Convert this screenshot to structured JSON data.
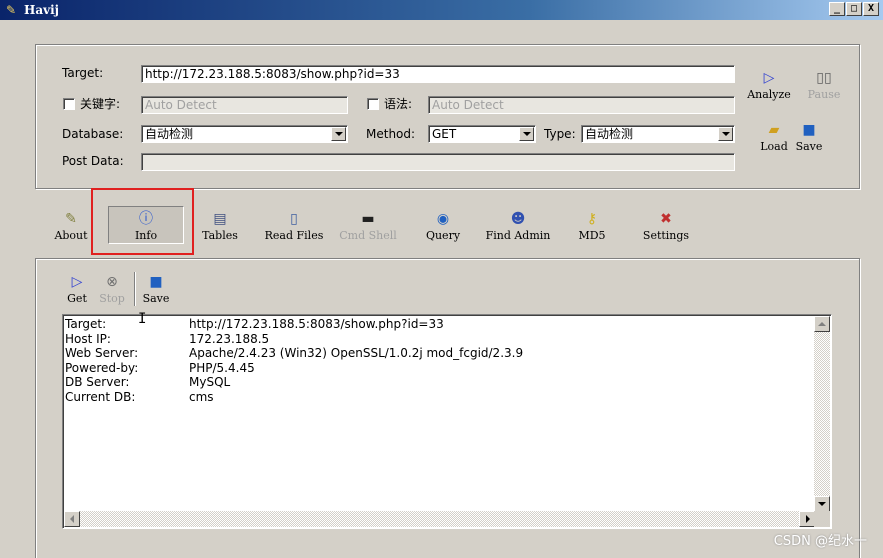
{
  "window": {
    "title": "Havij",
    "min": "_",
    "max": "□",
    "close": "X"
  },
  "form": {
    "target_label": "Target:",
    "target_value": "http://172.23.188.5:8083/show.php?id=33",
    "keyword_label": "关键字:",
    "keyword_placeholder": "Auto Detect",
    "syntax_label": "语法:",
    "syntax_placeholder": "Auto Detect",
    "database_label": "Database:",
    "database_value": "自动检测",
    "method_label": "Method:",
    "method_value": "GET",
    "type_label": "Type:",
    "type_value": "自动检测",
    "postdata_label": "Post Data:",
    "postdata_value": ""
  },
  "side_buttons": {
    "analyze": "Analyze",
    "pause": "Pause",
    "load": "Load",
    "save": "Save"
  },
  "tabs": [
    {
      "label": "About",
      "icon": "tool-icon"
    },
    {
      "label": "Info",
      "icon": "info-icon"
    },
    {
      "label": "Tables",
      "icon": "table-icon"
    },
    {
      "label": "Read Files",
      "icon": "file-icon"
    },
    {
      "label": "Cmd Shell",
      "icon": "terminal-icon"
    },
    {
      "label": "Query",
      "icon": "query-icon"
    },
    {
      "label": "Find Admin",
      "icon": "users-icon"
    },
    {
      "label": "MD5",
      "icon": "key-icon"
    },
    {
      "label": "Settings",
      "icon": "settings-icon"
    }
  ],
  "info_toolbar": {
    "get": "Get",
    "stop": "Stop",
    "save": "Save"
  },
  "output": [
    {
      "key": "Target:",
      "value": "http://172.23.188.5:8083/show.php?id=33"
    },
    {
      "key": "Host IP:",
      "value": "172.23.188.5"
    },
    {
      "key": "Web Server:",
      "value": "Apache/2.4.23 (Win32) OpenSSL/1.0.2j mod_fcgid/2.3.9"
    },
    {
      "key": "Powered-by:",
      "value": "PHP/5.4.45"
    },
    {
      "key": "DB Server:",
      "value": "MySQL"
    },
    {
      "key": "Current DB:",
      "value": "cms"
    }
  ],
  "watermark": "CSDN @纪水一",
  "colors": {
    "titlebar": "#0a246a",
    "highlight": "#e02020",
    "face": "#d4d0c8"
  }
}
